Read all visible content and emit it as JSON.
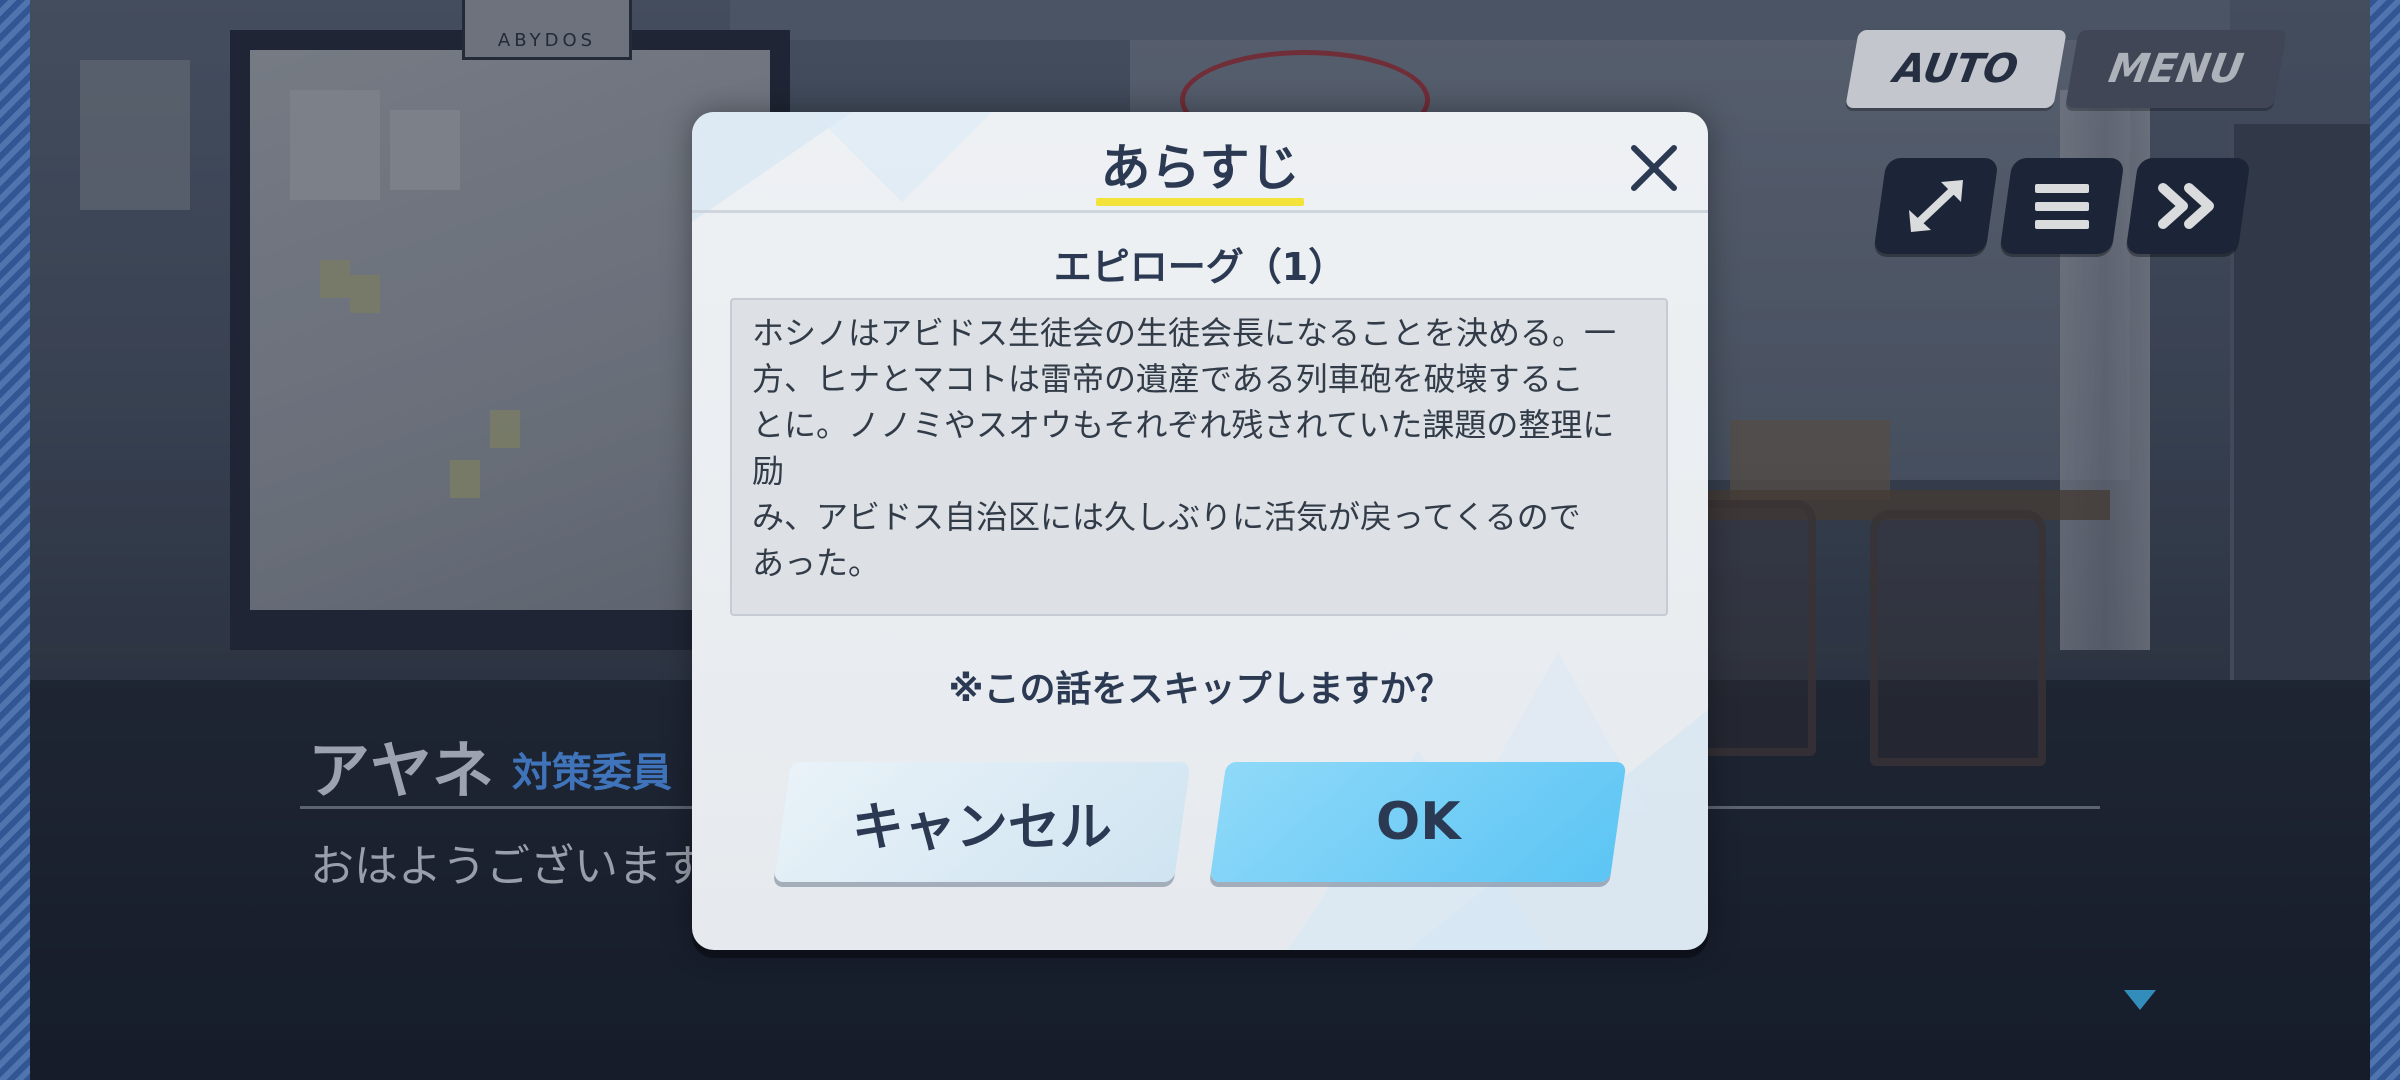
{
  "hud": {
    "auto_label": "AUTO",
    "menu_label": "MENU"
  },
  "scene": {
    "sign_text": "ABYDOS"
  },
  "dialogue": {
    "speaker": "アヤネ",
    "affiliation": "対策委員",
    "line": "おはようございます"
  },
  "modal": {
    "title": "あらすじ",
    "episode_title": "エピローグ（1）",
    "summary": "ホシノはアビドス生徒会の生徒会長になることを決める。一\n方、ヒナとマコトは雷帝の遺産である列車砲を破壊するこ\nとに。ノノミやスオウもそれぞれ残されていた課題の整理に励\nみ、アビドス自治区には久しぶりに活気が戻ってくるので\nあった。",
    "skip_question": "※この話をスキップしますか？",
    "cancel_label": "キャンセル",
    "ok_label": "OK"
  },
  "colors": {
    "title_underline": "#f2e23a",
    "ok_button": "#5cc5f4",
    "text_dark": "#2b3a52",
    "affiliation": "#4a87d6"
  },
  "icons": {
    "expand": "expand-arrows-icon",
    "log": "hamburger-log-icon",
    "skip": "fast-forward-icon",
    "close": "close-x-icon",
    "next": "triangle-down-icon"
  }
}
